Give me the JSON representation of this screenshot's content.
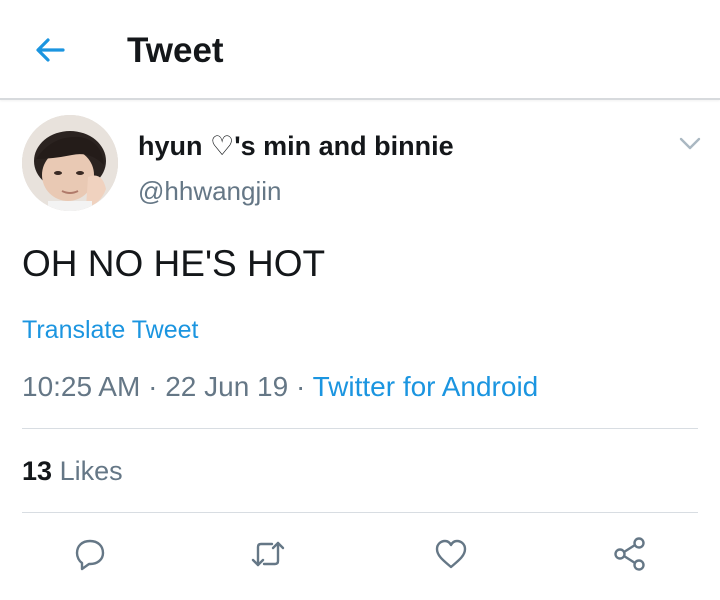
{
  "header": {
    "title": "Tweet",
    "back_icon": "arrow-left-icon"
  },
  "tweet": {
    "display_name": "hyun ♡'s min and binnie",
    "handle": "@hhwangjin",
    "text": "OH NO HE'S HOT",
    "translate_label": "Translate Tweet",
    "time": "10:25 AM",
    "date": "22 Jun 19",
    "separator": "·",
    "source": "Twitter for Android",
    "likes_count": "13",
    "likes_label": "Likes",
    "more_icon": "chevron-down-icon"
  },
  "actions": [
    {
      "name": "reply",
      "icon": "reply-icon"
    },
    {
      "name": "retweet",
      "icon": "retweet-icon"
    },
    {
      "name": "like",
      "icon": "heart-icon"
    },
    {
      "name": "share",
      "icon": "share-icon"
    }
  ],
  "colors": {
    "accent": "#1b95e0",
    "text_primary": "#14171a",
    "text_secondary": "#657786",
    "icon_gray": "#657786",
    "divider": "#d8dde2"
  }
}
